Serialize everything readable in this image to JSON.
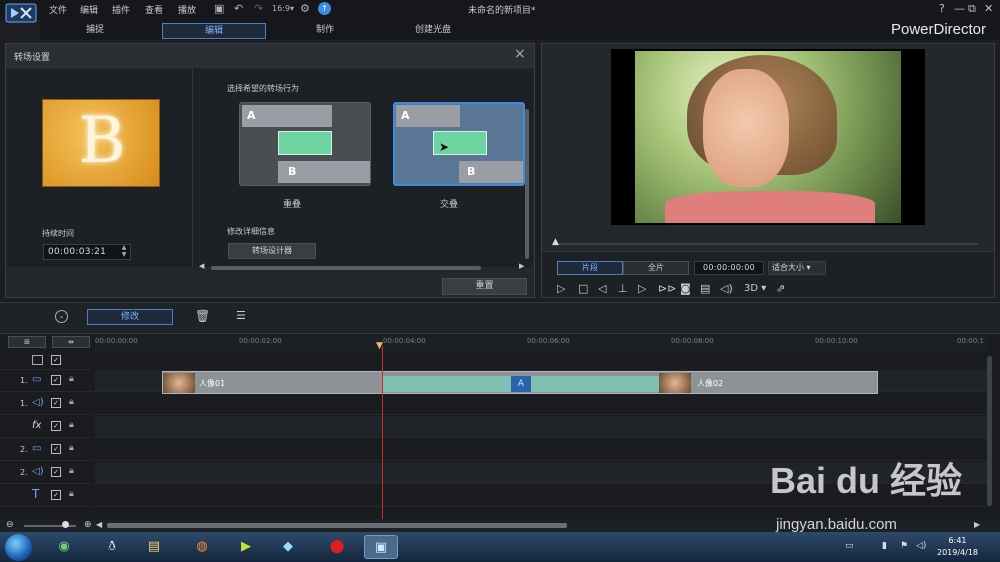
{
  "app": {
    "brand": "PowerDirector",
    "project_title": "未命名的新项目*"
  },
  "menu": [
    "文件",
    "编辑",
    "插件",
    "查看",
    "播放"
  ],
  "modes": {
    "capture": "捕捉",
    "edit": "编辑",
    "produce": "制作",
    "disc": "创建光盘"
  },
  "window_buttons": [
    "?",
    "—",
    "⧉",
    "✕"
  ],
  "transition_panel": {
    "title": "转场设置",
    "thumb_letter": "B",
    "duration_label": "持续时间",
    "duration_value": "00:00:03:21",
    "behavior_label": "选择希望的转场行为",
    "option_overlap": "重叠",
    "option_cross": "交叠",
    "letter_a": "A",
    "letter_b": "B",
    "detail_label": "修改详细信息",
    "designer_button": "转场设计器",
    "reset_button": "重置"
  },
  "preview": {
    "segment_clip": "片段",
    "segment_full": "全片",
    "timecode": "00:00:00:00",
    "fit": "适合大小",
    "mode_3d": "3D"
  },
  "toolbar": {
    "modify": "修改"
  },
  "timeline": {
    "ticks": [
      "00:00:00:00",
      "00:00:02:00",
      "00:00:04:00",
      "00:00:06:00",
      "00:00:08:00",
      "00:00:10:00",
      "00:00:1"
    ],
    "tracks": [
      {
        "num": "1.",
        "icon": "video-track-icon"
      },
      {
        "num": "1.",
        "icon": "audio-track-icon"
      },
      {
        "num": "",
        "icon": "fx-track-icon"
      },
      {
        "num": "2.",
        "icon": "video-track-icon"
      },
      {
        "num": "2.",
        "icon": "audio-track-icon"
      },
      {
        "num": "",
        "icon": "title-track-icon"
      }
    ],
    "clip1": "人像01",
    "clip2": "人像02"
  },
  "taskbar": {
    "time": "6:41",
    "date": "2019/4/18"
  },
  "watermark": {
    "main": "Bai du 经验",
    "sub": "jingyan.baidu.com"
  },
  "colors": {
    "accent": "#3a8de0",
    "transition": "#6dd3a0",
    "playhead": "#d0282a"
  }
}
